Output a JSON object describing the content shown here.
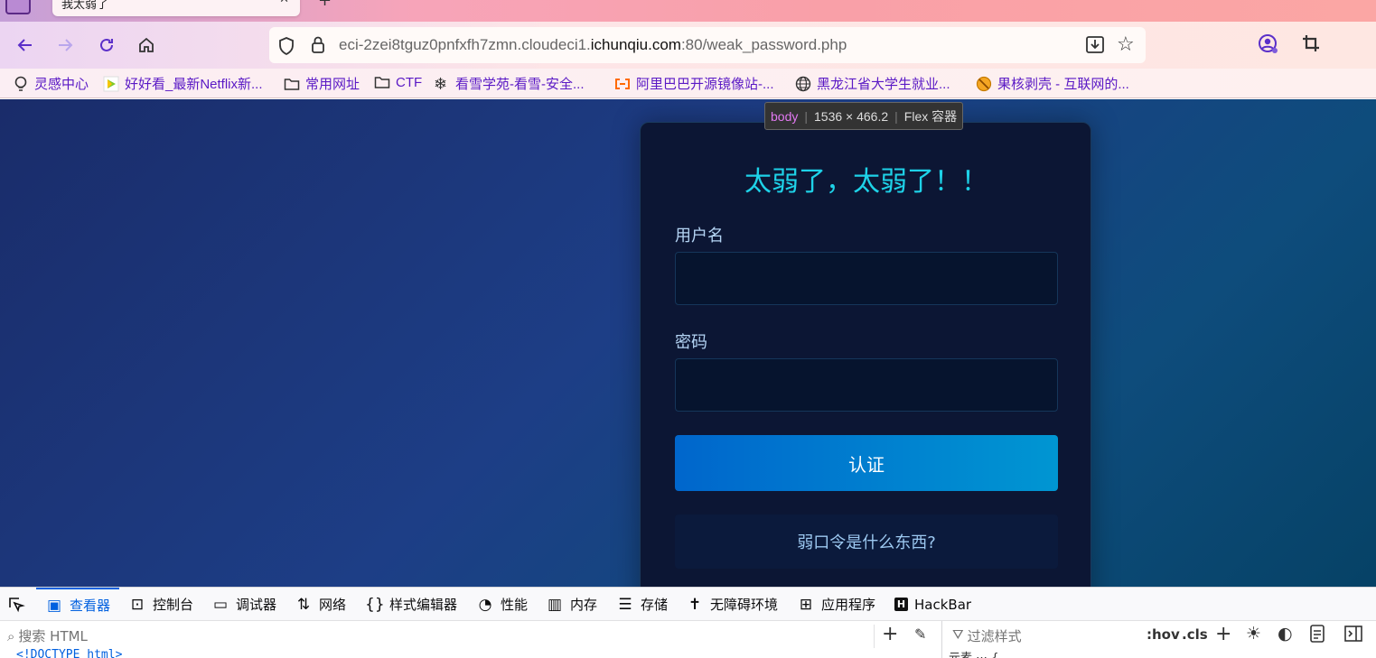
{
  "browser": {
    "tab_title": "我太弱了",
    "new_tab": "+",
    "url_prefix": "eci-2zei8tguz0pnfxfh7zmn.cloudeci1.",
    "url_domain": "ichunqiu.com",
    "url_suffix": ":80/weak_password.php"
  },
  "bookmarks": [
    {
      "label": "灵感中心",
      "icon": "bulb-icon"
    },
    {
      "label": "好好看_最新Netflix新...",
      "icon": "play-icon"
    },
    {
      "label": "常用网址",
      "icon": "folder-icon"
    },
    {
      "label": "CTF",
      "icon": "folder-icon"
    },
    {
      "label": "看雪学苑-看雪-安全...",
      "icon": "snowflake-icon"
    },
    {
      "label": "阿里巴巴开源镜像站-...",
      "icon": "aliyun-icon"
    },
    {
      "label": "黑龙江省大学生就业...",
      "icon": "globe-icon"
    },
    {
      "label": "果核剥壳 - 互联网的...",
      "icon": "ban-icon"
    }
  ],
  "inspector_tag": {
    "element": "body",
    "size": "1536 × 466.2",
    "type": "Flex 容器"
  },
  "login": {
    "title": "太弱了，太弱了！！",
    "username_label": "用户名",
    "password_label": "密码",
    "submit_label": "认证",
    "help_link": "弱口令是什么东西?"
  },
  "devtools": {
    "tabs": [
      "查看器",
      "控制台",
      "调试器",
      "网络",
      "样式编辑器",
      "性能",
      "内存",
      "存储",
      "无障碍环境",
      "应用程序",
      "HackBar"
    ],
    "active_tab": "查看器",
    "search_placeholder": "搜索 HTML",
    "filter_placeholder": "过滤样式",
    "hov": ":hov",
    "cls": ".cls",
    "doctype_snippet": "<!DOCTYPE html>",
    "rule_snippet": "元素 ⋯ {"
  },
  "colors": {
    "accent": "#1ed2e8",
    "button_start": "#0066cc",
    "button_end": "#0096d2",
    "card_bg": "#0c1634",
    "devtools_active": "#0060df"
  }
}
